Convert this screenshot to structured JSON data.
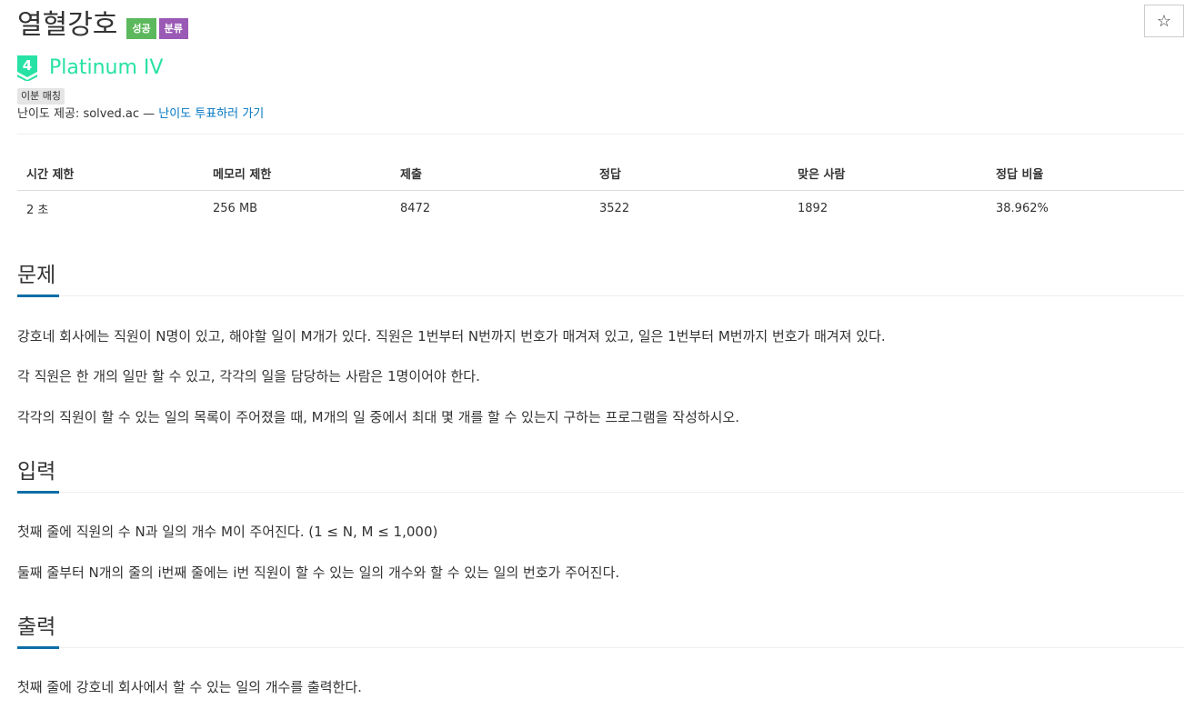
{
  "header": {
    "title": "열혈강호",
    "labels": {
      "success": "성공",
      "category": "분류"
    },
    "star_icon": "☆"
  },
  "tier": {
    "level": "4",
    "name": "Platinum IV",
    "color": "#27e2a4"
  },
  "tag": "이분 매칭",
  "credit": {
    "prefix": "난이도 제공: solved.ac — ",
    "link": "난이도 투표하러 가기"
  },
  "info_table": {
    "headers": [
      "시간 제한",
      "메모리 제한",
      "제출",
      "정답",
      "맞은 사람",
      "정답 비율"
    ],
    "values": [
      "2 초",
      "256 MB",
      "8472",
      "3522",
      "1892",
      "38.962%"
    ]
  },
  "sections": {
    "description": {
      "title": "문제",
      "paragraphs": [
        "강호네 회사에는 직원이 N명이 있고, 해야할 일이 M개가 있다. 직원은 1번부터 N번까지 번호가 매겨져 있고, 일은 1번부터 M번까지 번호가 매겨져 있다.",
        "각 직원은 한 개의 일만 할 수 있고, 각각의 일을 담당하는 사람은 1명이어야 한다.",
        "각각의 직원이 할 수 있는 일의 목록이 주어졌을 때, M개의 일 중에서 최대 몇 개를 할 수 있는지 구하는 프로그램을 작성하시오."
      ]
    },
    "input": {
      "title": "입력",
      "paragraphs": [
        "첫째 줄에 직원의 수 N과 일의 개수 M이 주어진다. (1 ≤ N, M ≤ 1,000)",
        "둘째 줄부터 N개의 줄의 i번째 줄에는 i번 직원이 할 수 있는 일의 개수와 할 수 있는 일의 번호가 주어진다."
      ]
    },
    "output": {
      "title": "출력",
      "paragraphs": [
        "첫째 줄에 강호네 회사에서 할 수 있는 일의 개수를 출력한다."
      ]
    }
  },
  "colors": {
    "success": "#5cb85c",
    "category": "#9b59b6",
    "link": "#0076c0",
    "section_accent": "#0d6ea6"
  }
}
